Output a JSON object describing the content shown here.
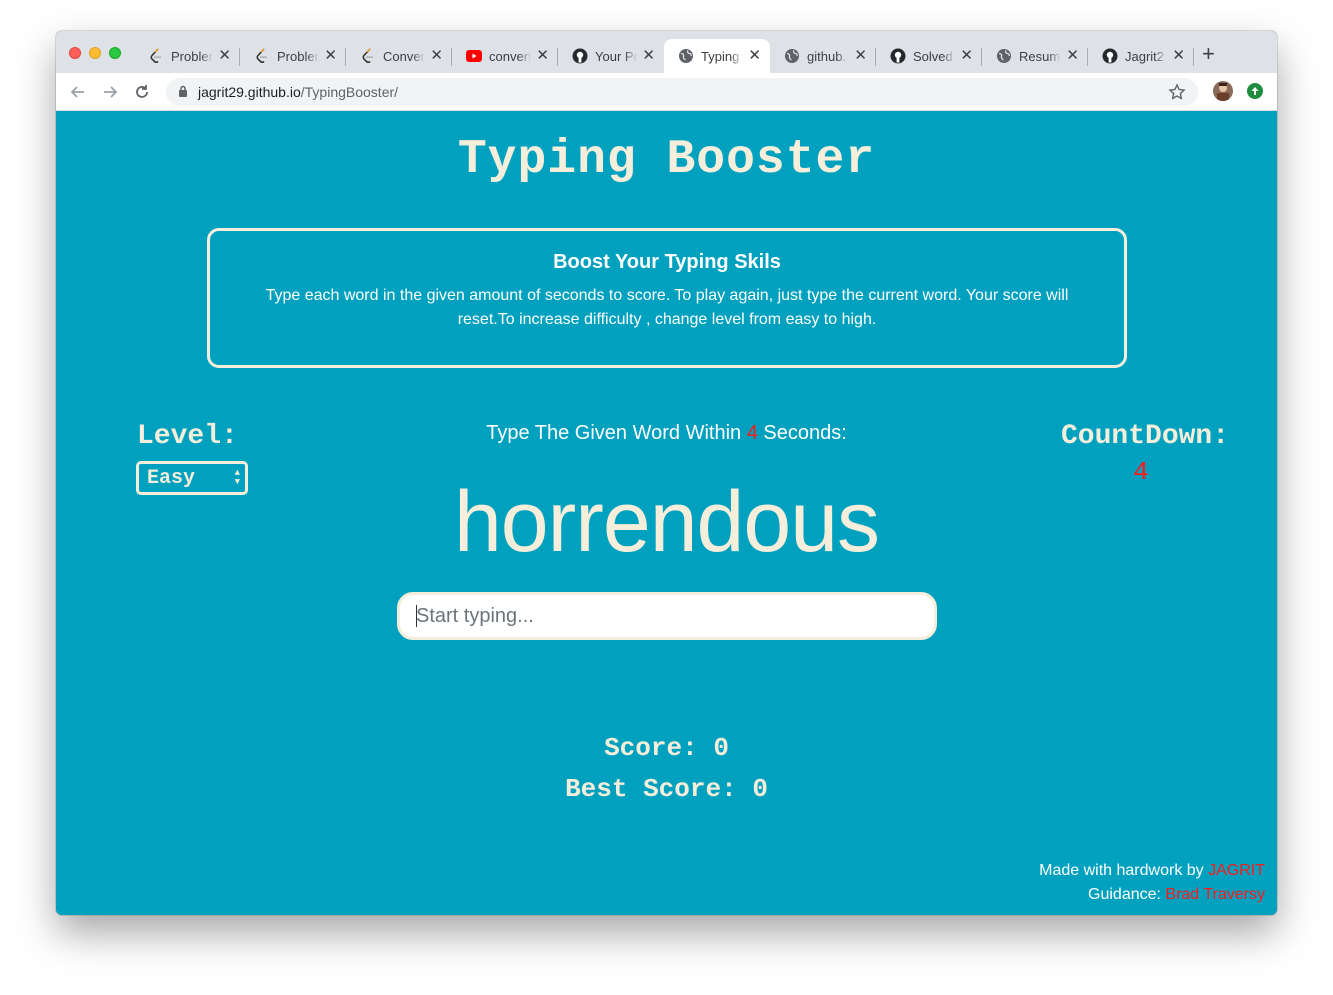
{
  "browser": {
    "tabs": [
      {
        "title": "Problem",
        "icon": "leetcode-icon",
        "active": false
      },
      {
        "title": "Problem",
        "icon": "leetcode-icon",
        "active": false
      },
      {
        "title": "Convert",
        "icon": "leetcode-icon",
        "active": false
      },
      {
        "title": "convert",
        "icon": "youtube-icon",
        "active": false
      },
      {
        "title": "Your Pr",
        "icon": "github-icon",
        "active": false
      },
      {
        "title": "Typing",
        "icon": "globe-icon",
        "active": true
      },
      {
        "title": "github.",
        "icon": "globe-icon",
        "active": false
      },
      {
        "title": "Solved",
        "icon": "github-icon",
        "active": false
      },
      {
        "title": "Resume",
        "icon": "globe-icon",
        "active": false
      },
      {
        "title": "Jagrit2",
        "icon": "github-icon",
        "active": false
      }
    ],
    "address": {
      "host": "jagrit29.github.io",
      "path": "/TypingBooster/"
    }
  },
  "page": {
    "title": "Typing Booster",
    "card": {
      "title": "Boost Your Typing Skils",
      "text": "Type each word in the given amount of seconds to score. To play again, just type the current word. Your score will reset.To increase difficulty , change level from easy to high."
    },
    "level": {
      "label": "Level:",
      "selected": "Easy"
    },
    "instruction": {
      "prefix": "Type The Given Word Within",
      "seconds": "4",
      "suffix": "Seconds:"
    },
    "countdown": {
      "label": "CountDown:",
      "value": "4"
    },
    "current_word": "horrendous",
    "input": {
      "placeholder": "Start typing...",
      "value": ""
    },
    "score": {
      "label": "Score:",
      "value": "0"
    },
    "best_score": {
      "label": "Best Score:",
      "value": "0"
    },
    "footer": {
      "made_prefix": "Made with hardwork by",
      "author": "JAGRIT",
      "guidance_prefix": "Guidance:",
      "guide": "Brad Traversy"
    }
  },
  "colors": {
    "background": "#00a0bf",
    "text_cream": "#f5eedb",
    "highlight_red": "#ff1a1a"
  }
}
